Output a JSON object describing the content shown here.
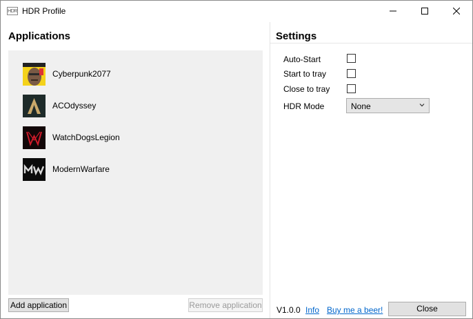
{
  "window": {
    "title": "HDR Profile",
    "icon_text": "HDR",
    "controls": [
      "minimize-icon",
      "maximize-icon",
      "close-icon"
    ]
  },
  "applications": {
    "heading": "Applications",
    "items": [
      {
        "name": "Cyberpunk2077",
        "icon": "cyberpunk-game-icon"
      },
      {
        "name": "ACOdyssey",
        "icon": "ac-odyssey-game-icon"
      },
      {
        "name": "WatchDogsLegion",
        "icon": "watchdogs-legion-game-icon"
      },
      {
        "name": "ModernWarfare",
        "icon": "modern-warfare-game-icon"
      }
    ],
    "add_label": "Add application",
    "remove_label": "Remove application"
  },
  "settings": {
    "heading": "Settings",
    "auto_start": {
      "label": "Auto-Start",
      "checked": false
    },
    "start_to_tray": {
      "label": "Start to tray",
      "checked": false
    },
    "close_to_tray": {
      "label": "Close to tray",
      "checked": false
    },
    "hdr_mode": {
      "label": "HDR Mode",
      "value": "None"
    }
  },
  "footer": {
    "version": "V1.0.0",
    "info_link": "Info",
    "beer_link": "Buy me a beer!",
    "close_label": "Close"
  },
  "colors": {
    "link": "#0066cc",
    "list_background": "#f0f0f0",
    "button_background": "#e1e1e1"
  }
}
